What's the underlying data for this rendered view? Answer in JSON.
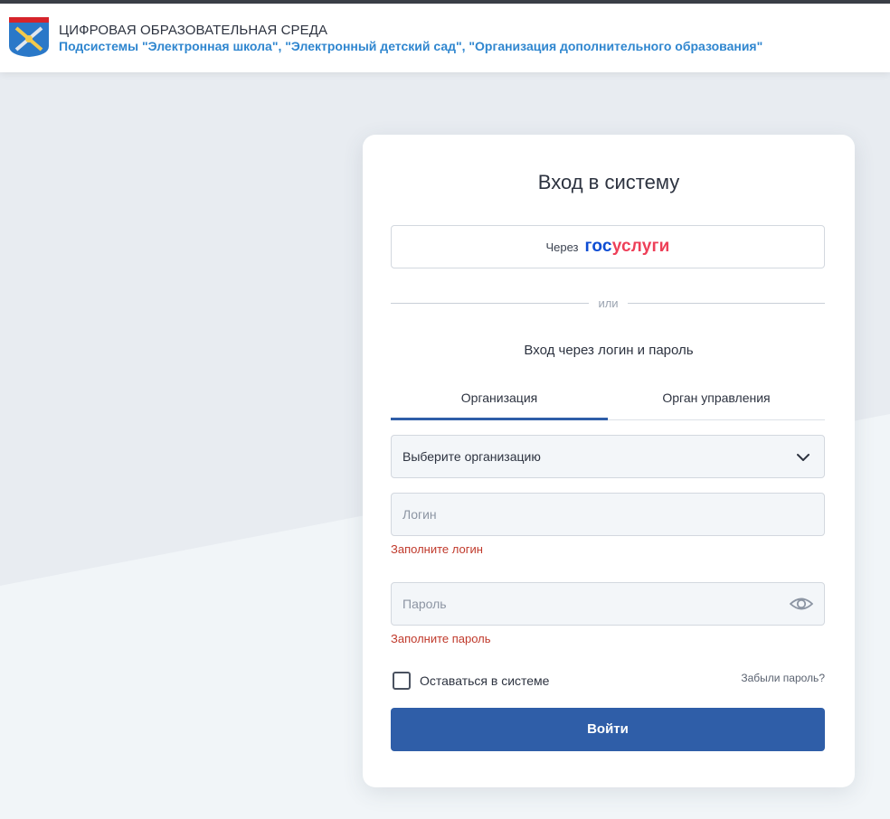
{
  "header": {
    "title": "ЦИФРОВАЯ ОБРАЗОВАТЕЛЬНАЯ СРЕДА",
    "subtitle": "Подсистемы \"Электронная школа\", \"Электронный детский сад\", \"Организация дополнительного образования\""
  },
  "login": {
    "title": "Вход в систему",
    "gosuslugi": {
      "prefix": "Через",
      "logo_part1": "гос",
      "logo_part2": "услуги"
    },
    "divider_text": "или",
    "subtitle": "Вход через логин и пароль",
    "tabs": [
      {
        "label": "Организация",
        "active": true
      },
      {
        "label": "Орган управления",
        "active": false
      }
    ],
    "org_select": {
      "value": "Выберите организацию"
    },
    "login_field": {
      "placeholder": "Логин",
      "error": "Заполните логин"
    },
    "password_field": {
      "placeholder": "Пароль",
      "error": "Заполните пароль"
    },
    "remember_label": "Оставаться в системе",
    "forgot_label": "Забыли пароль?",
    "submit_label": "Войти"
  },
  "colors": {
    "accent": "#2f5ea8",
    "link_blue": "#2f86cf",
    "error": "#c0392b",
    "gos_blue": "#0d4cd3",
    "gos_red": "#ee3f58"
  },
  "icons": [
    "coat-of-arms-logo",
    "chevron-down-icon",
    "eye-icon"
  ]
}
